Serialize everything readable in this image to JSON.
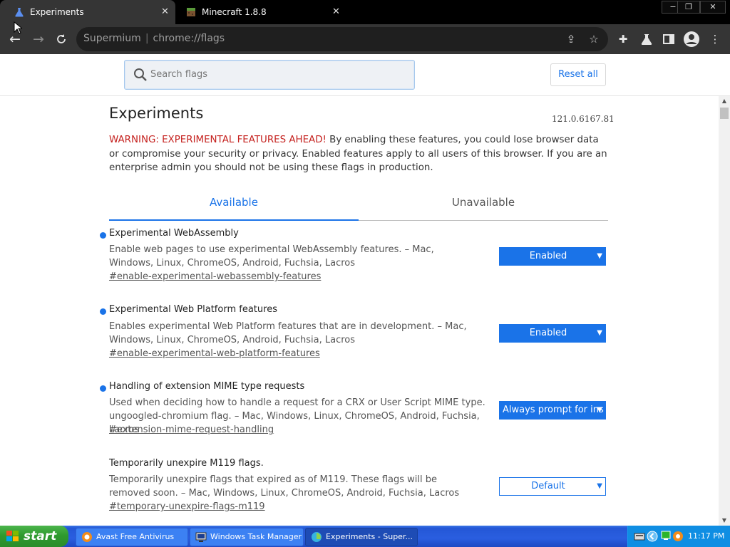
{
  "browser": {
    "tabs": [
      {
        "title": "Experiments",
        "active": true,
        "icon": "flask-icon"
      },
      {
        "title": "Minecraft 1.8.8",
        "active": false,
        "icon": "minecraft-block-icon"
      }
    ],
    "window_controls": {
      "minimize": "−",
      "restore": "❐",
      "close": "✕"
    },
    "omnibox": {
      "site": "Supermium",
      "url": "chrome://flags"
    }
  },
  "flags_page": {
    "search_placeholder": "Search flags",
    "reset_label": "Reset all",
    "title": "Experiments",
    "version": "121.0.6167.81",
    "warning_prefix": "WARNING: EXPERIMENTAL FEATURES AHEAD!",
    "warning_body": " By enabling these features, you could lose browser data or compromise your security or privacy. Enabled features apply to all users of this browser. If you are an enterprise admin you should not be using these flags in production.",
    "tabs": {
      "available": "Available",
      "unavailable": "Unavailable"
    },
    "flags": [
      {
        "name": "Experimental WebAssembly",
        "description": "Enable web pages to use experimental WebAssembly features. – Mac, Windows, Linux, ChromeOS, Android, Fuchsia, Lacros",
        "link": "#enable-experimental-webassembly-features",
        "value": "Enabled",
        "modified": true
      },
      {
        "name": "Experimental Web Platform features",
        "description": "Enables experimental Web Platform features that are in development. – Mac, Windows, Linux, ChromeOS, Android, Fuchsia, Lacros",
        "link": "#enable-experimental-web-platform-features",
        "value": "Enabled",
        "modified": true
      },
      {
        "name": "Handling of extension MIME type requests",
        "description": "Used when deciding how to handle a request for a CRX or User Script MIME type. ungoogled-chromium flag. – Mac, Windows, Linux, ChromeOS, Android, Fuchsia, Lacros",
        "link": "#extension-mime-request-handling",
        "value": "Always prompt for ins",
        "modified": true
      },
      {
        "name": "Temporarily unexpire M119 flags.",
        "description": "Temporarily unexpire flags that expired as of M119. These flags will be removed soon. – Mac, Windows, Linux, ChromeOS, Android, Fuchsia, Lacros",
        "link": "#temporary-unexpire-flags-m119",
        "value": "Default",
        "modified": false
      }
    ]
  },
  "taskbar": {
    "start_label": "start",
    "items": [
      {
        "label": "Avast Free Antivirus",
        "icon": "avast-icon",
        "active": false
      },
      {
        "label": "Windows Task Manager",
        "icon": "task-manager-icon",
        "active": false
      },
      {
        "label": "Experiments - Super...",
        "icon": "supermium-icon",
        "active": true
      }
    ],
    "clock": "11:17 PM"
  },
  "colors": {
    "accent": "#1a73e8",
    "warning": "#c5221f",
    "toolbar": "#353535",
    "taskbar": "#2457d6",
    "start_button": "#2f9a2f"
  }
}
